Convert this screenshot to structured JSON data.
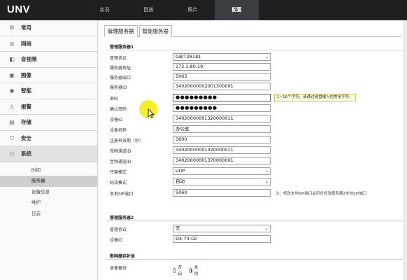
{
  "app": {
    "logo": "UNV"
  },
  "topnav": {
    "tabs": [
      {
        "label": "实况"
      },
      {
        "label": "回放"
      },
      {
        "label": "照片"
      },
      {
        "label": "配置"
      }
    ],
    "active_index": 3
  },
  "sidebar": {
    "items": [
      {
        "label": "常用",
        "icon": "gear-icon"
      },
      {
        "label": "网络",
        "icon": "globe-icon"
      },
      {
        "label": "音视频",
        "icon": "speaker-icon"
      },
      {
        "label": "图像",
        "icon": "image-icon"
      },
      {
        "label": "智能",
        "icon": "smart-icon"
      },
      {
        "label": "报警",
        "icon": "alarm-icon"
      },
      {
        "label": "存储",
        "icon": "storage-icon"
      },
      {
        "label": "安全",
        "icon": "shield-icon"
      },
      {
        "label": "系统",
        "icon": "folder-icon"
      }
    ],
    "active_index": 8,
    "sub_items": [
      {
        "label": "时间"
      },
      {
        "label": "服务器"
      },
      {
        "label": "设备信息"
      },
      {
        "label": "维护"
      },
      {
        "label": "日志"
      }
    ],
    "active_sub_index": 1
  },
  "main": {
    "tabs": [
      {
        "label": "管理服务器"
      },
      {
        "label": "智能服务器"
      }
    ],
    "active_tab": 0,
    "server1": {
      "title": "管理服务器1",
      "protocol_label": "管理协议",
      "protocol_value": "GB/T28181",
      "addr_label": "服务器地址",
      "addr_value": "172.1.80.19",
      "port_label": "服务器端口",
      "port_value": "5063",
      "id_label": "服务器ID",
      "id_value": "34020000002001300001",
      "pwd_label": "密码",
      "pwd_value": "●●●●●●●●●",
      "pwd_hint": "1~16个字符，请通过键盘输入的常用字符。",
      "confirm_label": "确认密码",
      "confirm_value": "●●●●●●●●●",
      "devid_label": "设备ID",
      "devid_value": "34020000001320000011",
      "devname_label": "设备名称",
      "devname_value": "办公室",
      "reg_label": "注册有效期（秒）",
      "reg_value": "3600",
      "video_label": "视频通道ID",
      "video_value": "34020000001320000011",
      "audio_label": "音频通道ID",
      "audio_value": "34020000001370000001",
      "transport_label": "传输模式",
      "transport_value": "UDP",
      "stream_label": "码流模式",
      "stream_value": "自动",
      "sip_label": "本地SIP端口",
      "sip_value": "5060",
      "sip_note": "注：修改本地SIP端口会同步修改服务器2本地SIP端口"
    },
    "server2": {
      "title": "管理服务器2",
      "protocol_label": "管理协议",
      "protocol_value": "无",
      "devid_label": "设备ID",
      "devid_value": "D4-74-CE"
    },
    "backup": {
      "title": "断网缓存补录",
      "rec_label": "录像备份",
      "opt_on": "开启",
      "opt_off": "关闭",
      "selected": "关闭"
    }
  }
}
